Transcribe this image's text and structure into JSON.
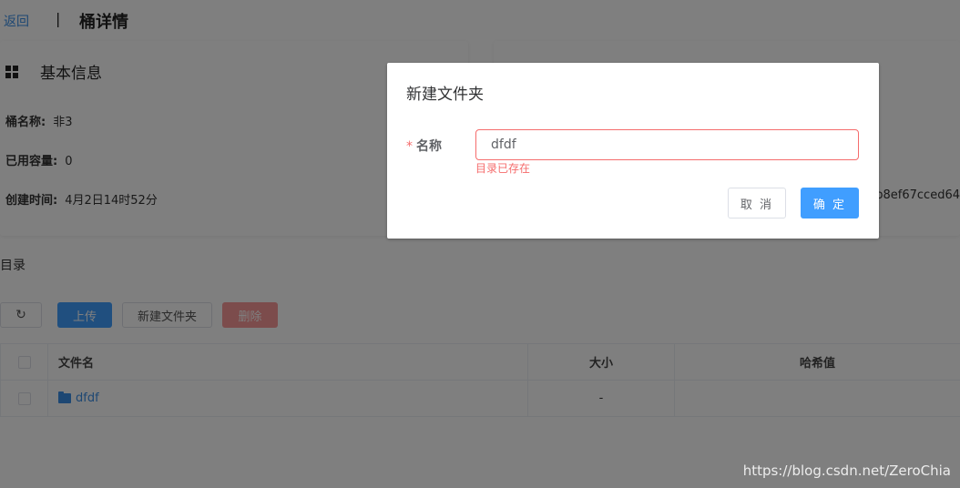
{
  "header": {
    "back_label": "返回",
    "separator": "|",
    "title": "桶详情"
  },
  "basic_info": {
    "title": "基本信息",
    "rows": [
      {
        "key": "桶名称:",
        "value": "非3"
      },
      {
        "key": "已用容量:",
        "value": "0"
      },
      {
        "key": "创建时间:",
        "value": "4月2日14时52分"
      }
    ]
  },
  "access_info": {
    "title": "",
    "partial_value": "b8ef67cced64"
  },
  "directory": {
    "label": "目录",
    "toolbar": {
      "refresh_icon": "↻",
      "upload_label": "上传",
      "new_folder_label": "新建文件夹",
      "delete_label": "删除"
    },
    "columns": {
      "name": "文件名",
      "size": "大小",
      "hash": "哈希值"
    },
    "rows": [
      {
        "name": "dfdf",
        "size": "-",
        "hash": "",
        "type": "folder"
      }
    ]
  },
  "dialog": {
    "title": "新建文件夹",
    "field_required_mark": "*",
    "field_label": "名称",
    "field_value": "dfdf",
    "error_message": "目录已存在",
    "cancel_label": "取 消",
    "confirm_label": "确 定"
  },
  "watermark": "https://blog.csdn.net/ZeroChia",
  "colors": {
    "primary": "#409eff",
    "danger": "#f56c6c",
    "link": "#3a8ee6"
  }
}
